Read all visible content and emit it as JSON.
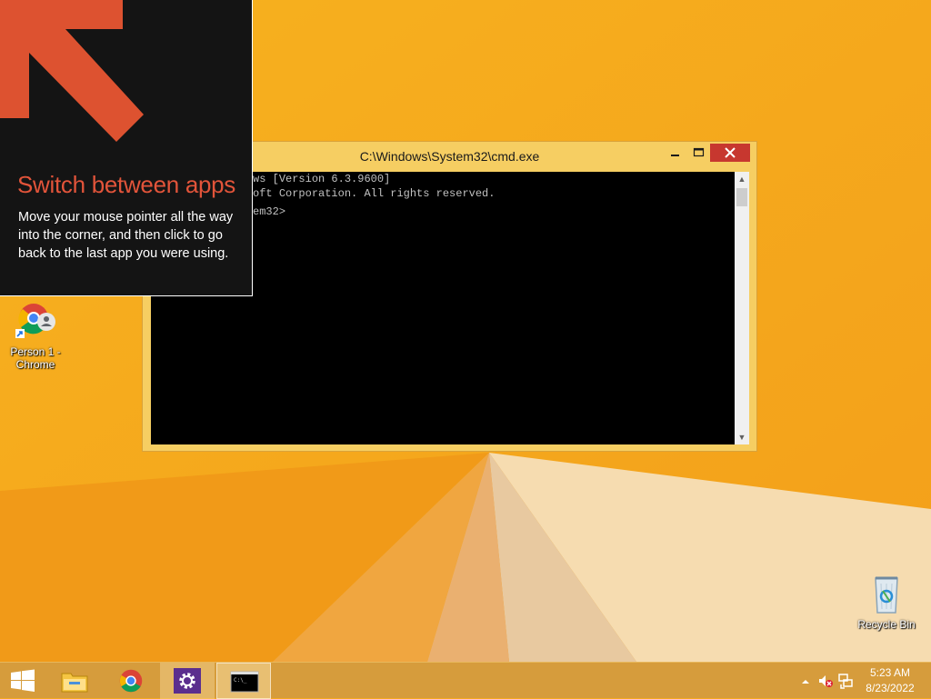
{
  "tip": {
    "title": "Switch between apps",
    "body": "Move your mouse pointer all the way into the corner, and then click to go back to the last app you were using."
  },
  "window": {
    "title": "C:\\Windows\\System32\\cmd.exe",
    "console_lines": [
      "Microsoft Windows [Version 6.3.9600]",
      "(c) 2013 Microsoft Corporation. All rights reserved.",
      "",
      "C:\\Windows\\system32>"
    ]
  },
  "desktop": {
    "icons": [
      {
        "label": "Person 1 - Chrome",
        "icon": "chrome-profile-icon"
      },
      {
        "label": "Recycle Bin",
        "icon": "recycle-bin-icon"
      }
    ]
  },
  "taskbar": {
    "items": [
      {
        "name": "Start",
        "icon": "windows-start-icon"
      },
      {
        "name": "File Explorer",
        "icon": "file-explorer-icon"
      },
      {
        "name": "Google Chrome",
        "icon": "chrome-icon"
      },
      {
        "name": "Settings",
        "icon": "gear-icon"
      },
      {
        "name": "Command Prompt",
        "icon": "cmd-icon",
        "active": true
      }
    ],
    "time": "5:23 AM",
    "date": "8/23/2022"
  },
  "colors": {
    "wallpaper": "#f5a820",
    "tip_accent": "#e2543a",
    "close_button": "#c7372f",
    "taskbar": "#d69c3c"
  }
}
